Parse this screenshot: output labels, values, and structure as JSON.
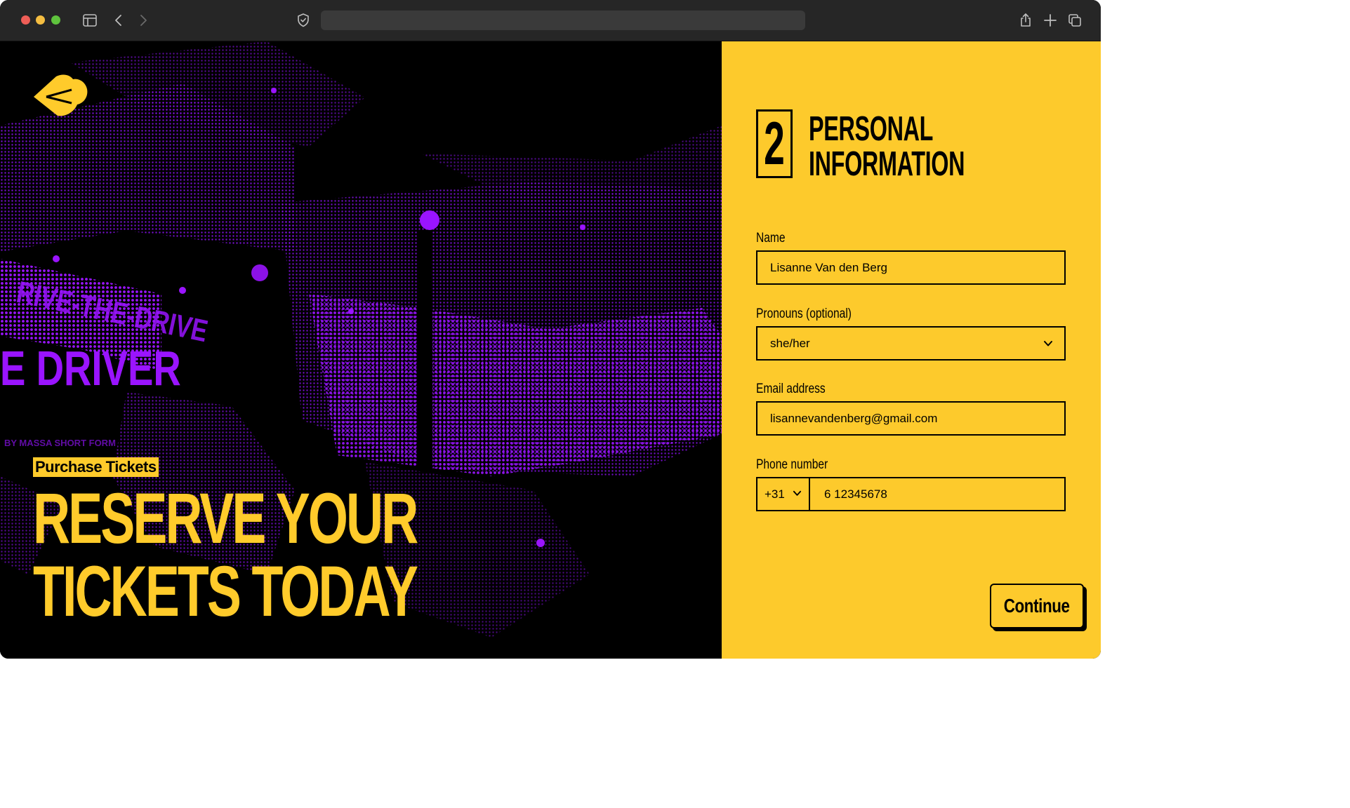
{
  "browser": {
    "address": "",
    "icons": [
      "close-window",
      "minimize-window",
      "zoom-window",
      "sidebar-icon",
      "back-arrow-icon",
      "forward-arrow-icon",
      "shield-icon",
      "share-icon",
      "new-tab-icon",
      "tab-overview-icon"
    ]
  },
  "hero": {
    "tag": "Purchase Tickets",
    "title_line1": "RESERVE YOUR",
    "title_line2": "TICKETS TODAY",
    "logo_icon": "brand-arrow-logo",
    "accent_color": "#ffcb2b",
    "image_color": "#9a14ff"
  },
  "form": {
    "step_number": "2",
    "title_line1": "PERSONAL",
    "title_line2": "INFORMATION",
    "panel_color": "#fdca2c",
    "name": {
      "label": "Name",
      "value": "Lisanne Van den Berg"
    },
    "pronouns": {
      "label": "Pronouns (optional)",
      "value": "she/her"
    },
    "email": {
      "label": "Email address",
      "value": "lisannevandenberg@gmail.com"
    },
    "phone": {
      "label": "Phone number",
      "country_code": "+31",
      "value": "6 12345678"
    },
    "continue_label": "Continue"
  }
}
